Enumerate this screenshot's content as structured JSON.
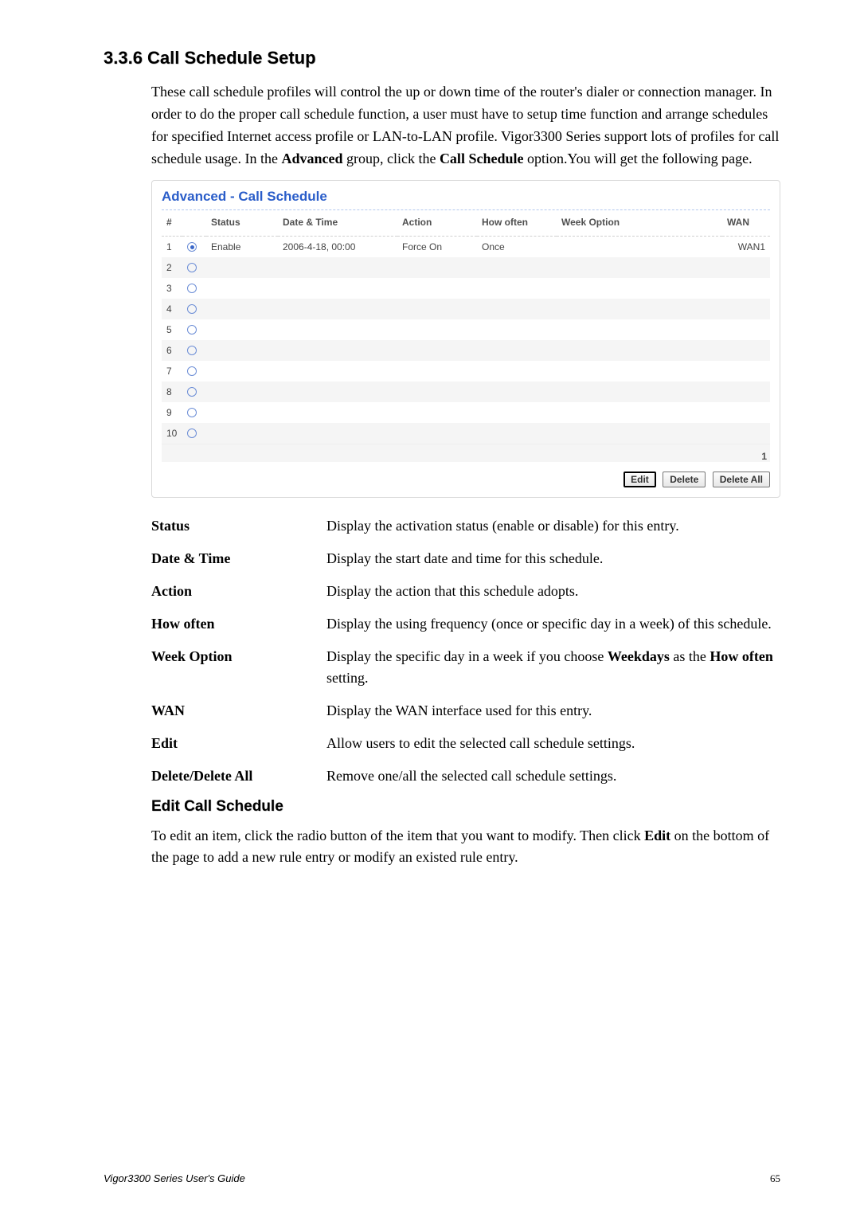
{
  "section_heading": "3.3.6 Call Schedule Setup",
  "intro": {
    "p1a": "These call schedule profiles will control the up or down time of the router's dialer or connection manager. In order to do the proper call schedule function, a user must have to setup time function and arrange schedules for specified Internet access profile or LAN-to-LAN profile. Vigor3300 Series support lots of profiles for call schedule usage. In the ",
    "p1b_bold": "Advanced",
    "p1c": " group, click the ",
    "p1d_bold": "Call Schedule",
    "p1e": " option.You will get the following page."
  },
  "screenshot": {
    "title": "Advanced - Call Schedule",
    "headers": {
      "num": "#",
      "status": "Status",
      "datetime": "Date & Time",
      "action": "Action",
      "howoften": "How often",
      "weekoption": "Week Option",
      "wan": "WAN"
    },
    "row1": {
      "num": "1",
      "status": "Enable",
      "datetime": "2006-4-18, 00:00",
      "action": "Force On",
      "howoften": "Once",
      "weekoption": "",
      "wan": "WAN1"
    },
    "rows_other": [
      "2",
      "3",
      "4",
      "5",
      "6",
      "7",
      "8",
      "9",
      "10"
    ],
    "pager": "1",
    "buttons": {
      "edit": "Edit",
      "delete": "Delete",
      "delete_all": "Delete All"
    }
  },
  "defs": {
    "status": {
      "term": "Status",
      "desc": "Display the activation status (enable or disable) for this entry."
    },
    "datetime": {
      "term": "Date & Time",
      "desc": "Display the start date and time for this schedule."
    },
    "action": {
      "term": "Action",
      "desc": "Display the action that this schedule adopts."
    },
    "howoften": {
      "term": "How often",
      "desc_a": "Display the using frequency (once or specific day in a week) of this schedule."
    },
    "weekoption": {
      "term": "Week Option",
      "a": "Display the specific day in a week if you choose ",
      "b_bold": "Weekdays",
      "c": " as the ",
      "d_bold": "How often",
      "e": " setting."
    },
    "wan": {
      "term": "WAN",
      "desc": "Display the WAN interface used for this entry."
    },
    "edit": {
      "term": "Edit",
      "desc": "Allow users to edit the selected call schedule settings."
    },
    "deleteall": {
      "term": "Delete/Delete All",
      "desc": "Remove one/all the selected call schedule settings."
    }
  },
  "sub_heading": "Edit Call Schedule",
  "edit_para": {
    "a": "To edit an item, click the radio button of the item that you want to modify. Then click ",
    "b_bold": "Edit",
    "c": " on the bottom of the page to add a new rule entry or modify an existed rule entry."
  },
  "footer": {
    "left": "Vigor3300 Series User's Guide",
    "page": "65"
  }
}
